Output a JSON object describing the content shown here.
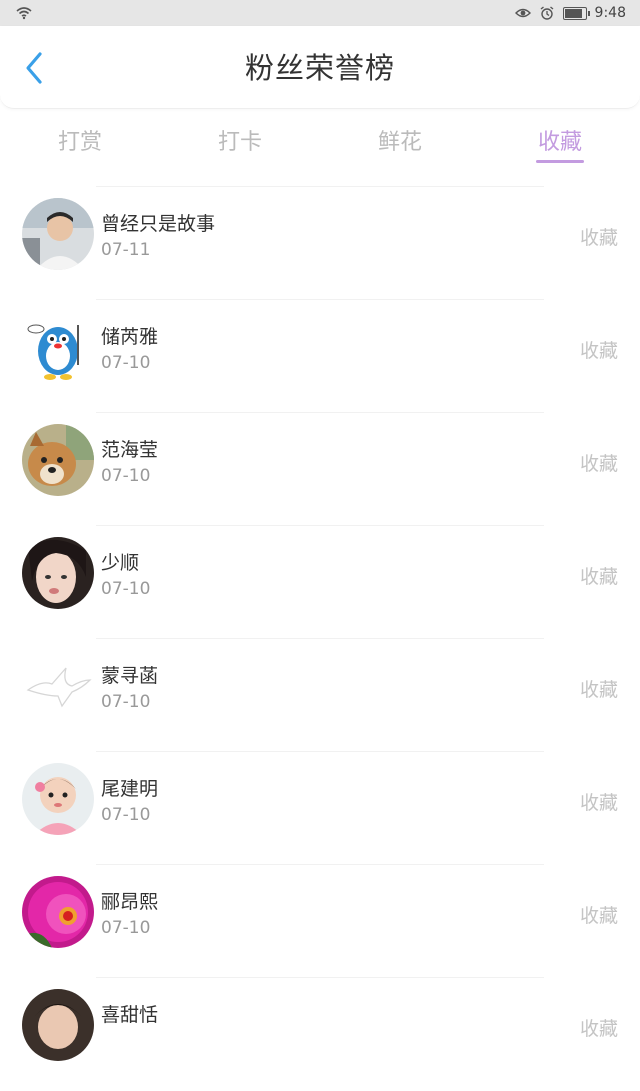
{
  "status_bar": {
    "time": "9:48"
  },
  "header": {
    "title": "粉丝荣誉榜"
  },
  "tabs": [
    {
      "label": "打赏",
      "active": false
    },
    {
      "label": "打卡",
      "active": false
    },
    {
      "label": "鲜花",
      "active": false
    },
    {
      "label": "收藏",
      "active": true
    }
  ],
  "colors": {
    "accent": "#c39be0",
    "back_arrow": "#3aa0e8"
  },
  "list": [
    {
      "name": "曾经只是故事",
      "date": "07-11",
      "action": "收藏",
      "avatar": "man-photo-avatar"
    },
    {
      "name": "储芮雅",
      "date": "07-10",
      "action": "收藏",
      "avatar": "penguin-cartoon-avatar"
    },
    {
      "name": "范海莹",
      "date": "07-10",
      "action": "收藏",
      "avatar": "dog-photo-avatar"
    },
    {
      "name": "少顺",
      "date": "07-10",
      "action": "收藏",
      "avatar": "girl-photo-avatar"
    },
    {
      "name": "蒙寻菡",
      "date": "07-10",
      "action": "收藏",
      "avatar": "bird-outline-avatar"
    },
    {
      "name": "尾建明",
      "date": "07-10",
      "action": "收藏",
      "avatar": "baby-photo-avatar"
    },
    {
      "name": "郦昂熙",
      "date": "07-10",
      "action": "收藏",
      "avatar": "pink-flower-avatar"
    },
    {
      "name": "喜甜恬",
      "date": "",
      "action": "收藏",
      "avatar": "person-photo-avatar"
    }
  ]
}
